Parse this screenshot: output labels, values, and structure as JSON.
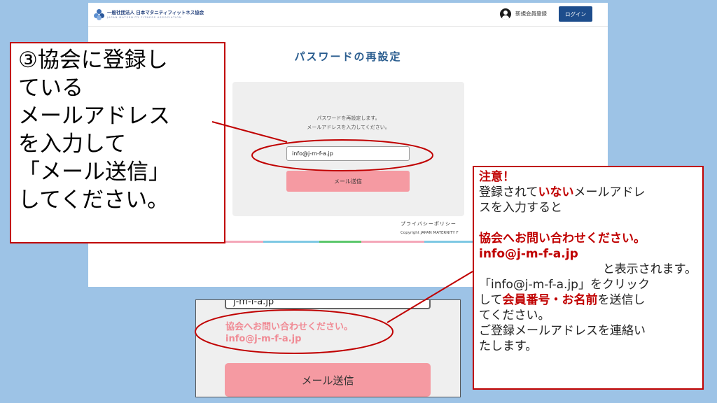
{
  "header": {
    "logo_text": "一般社団法人 日本マタニティフィットネス協会",
    "logo_sub": "JAPAN MATERNITY FITNESS ASSOCIATION",
    "signup_label": "新規会員登録",
    "login_label": "ログイン",
    "user_icon": "user-icon"
  },
  "page": {
    "title": "パスワードの再設定",
    "instruction_line1": "パスワードを再設定します。",
    "instruction_line2": "メールアドレスを入力してください。",
    "email_value": "info@j-m-f-a.jp",
    "send_label": "メール送信",
    "privacy_label": "プライバシーポリシー",
    "copyright": "Copyright JAPAN MATERNITY F"
  },
  "left_callout": {
    "lines": [
      "③協会に登録し",
      "ている",
      "メールアドレス",
      "を入力して",
      "「メール送信」",
      "してください。"
    ]
  },
  "inset": {
    "input_value": "j-m-f-a.jp",
    "error_line1": "協会へお問い合わせください。",
    "error_line2": "info@j-m-f-a.jp",
    "send_label": "メール送信"
  },
  "note": {
    "heading": "注意！",
    "l1_a": "登録されて",
    "l1_b": "いない",
    "l1_c": "メールアドレ",
    "l2": "スを入力すると",
    "l4": "協会へお問い合わせください。",
    "l5": "info@j-m-f-a.jp",
    "l6": "と表示されます。",
    "l7": "「info@j-m-f-a.jp」をクリック",
    "l8_a": "して",
    "l8_b": "会員番号・お名前",
    "l8_c": "を送信し",
    "l9": "てください。",
    "l10": "ご登録メールアドレスを連絡い",
    "l11": "たします。"
  },
  "colors": {
    "background": "#9dc3e6",
    "accent_red": "#c00000",
    "button_pink": "#f59aa2",
    "error_pink": "#f08a94",
    "login_blue": "#1d4d8c",
    "title_blue": "#2a5d8f"
  }
}
